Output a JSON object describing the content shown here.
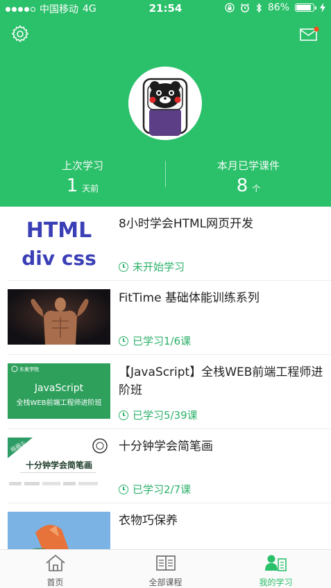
{
  "status_bar": {
    "carrier": "中国移动",
    "network": "4G",
    "time": "21:54",
    "battery_percent": "86%",
    "battery_level": 0.86
  },
  "header": {
    "settings_icon": "gear-icon",
    "mail_icon": "mail-icon",
    "has_unread": true,
    "stats": {
      "last_study_label": "上次学习",
      "last_study_value": "1",
      "last_study_unit": "天前",
      "monthly_label": "本月已学课件",
      "monthly_value": "8",
      "monthly_unit": "个"
    }
  },
  "courses": [
    {
      "title": "8小时学会HTML网页开发",
      "status": "未开始学习",
      "thumb": {
        "line1": "HTML",
        "line2": "div css"
      }
    },
    {
      "title": "FitTime 基础体能训练系列",
      "status": "已学习1/6课"
    },
    {
      "title": "【JavaScript】全栈WEB前端工程师进阶班",
      "status": "已学习5/39课",
      "thumb": {
        "brand": "东奥学院",
        "line1": "JavaScript",
        "line2": "全栈WEB前端工程师进阶班"
      }
    },
    {
      "title": "十分钟学会简笔画",
      "status": "已学习2/7课",
      "thumb": {
        "ribbon": "绘画①",
        "line1": "十分钟学会简笔画"
      }
    },
    {
      "title": "衣物巧保养",
      "status": ""
    }
  ],
  "tabs": [
    {
      "label": "首页",
      "icon": "home-icon"
    },
    {
      "label": "全部课程",
      "icon": "courses-icon"
    },
    {
      "label": "我的学习",
      "icon": "my-study-icon"
    }
  ],
  "colors": {
    "primary": "#2bc06a",
    "status_green": "#2bb06a",
    "html_blue": "#3b3fb6"
  }
}
